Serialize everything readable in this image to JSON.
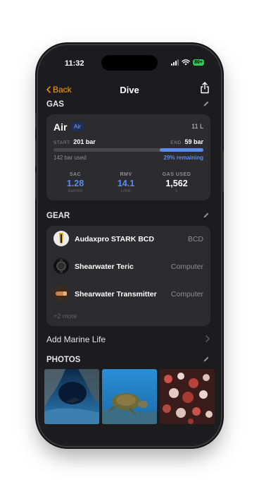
{
  "status_bar": {
    "time": "11:32",
    "battery": "80+"
  },
  "nav": {
    "back_label": "Back",
    "title": "Dive"
  },
  "gas": {
    "section_title": "GAS",
    "gas_name": "Air",
    "badge": "Air",
    "tank_volume": "11 L",
    "start_label": "START",
    "start_value": "201 bar",
    "end_label": "END",
    "end_value": "59 bar",
    "used_text": "142 bar used",
    "remaining_text": "29% remaining",
    "remaining_fraction": 0.29,
    "stats": [
      {
        "label": "SAC",
        "value": "1.28",
        "unit": "bar/min",
        "color": "#5b8def"
      },
      {
        "label": "RMV",
        "value": "14.1",
        "unit": "L/min",
        "color": "#5b8def"
      },
      {
        "label": "GAS USED",
        "value": "1,562",
        "unit": "L",
        "color": "#ffffff"
      }
    ]
  },
  "gear": {
    "section_title": "GEAR",
    "items": [
      {
        "name": "Audaxpro STARK BCD",
        "type": "BCD",
        "icon": "bcd-icon"
      },
      {
        "name": "Shearwater Teric",
        "type": "Computer",
        "icon": "dive-computer-icon"
      },
      {
        "name": "Shearwater Transmitter",
        "type": "Computer",
        "icon": "transmitter-icon"
      }
    ],
    "more_text": "+2 more"
  },
  "marine_life": {
    "label": "Add Marine Life"
  },
  "photos": {
    "section_title": "PHOTOS",
    "items": [
      {
        "subject": "underwater-cave-photo"
      },
      {
        "subject": "sea-turtle-photo"
      },
      {
        "subject": "coral-photo"
      }
    ]
  },
  "colors": {
    "accent_orange": "#ff9f0a",
    "accent_blue": "#5b8def",
    "card_background": "#2c2c2e",
    "screen_background": "#1c1c1e"
  }
}
